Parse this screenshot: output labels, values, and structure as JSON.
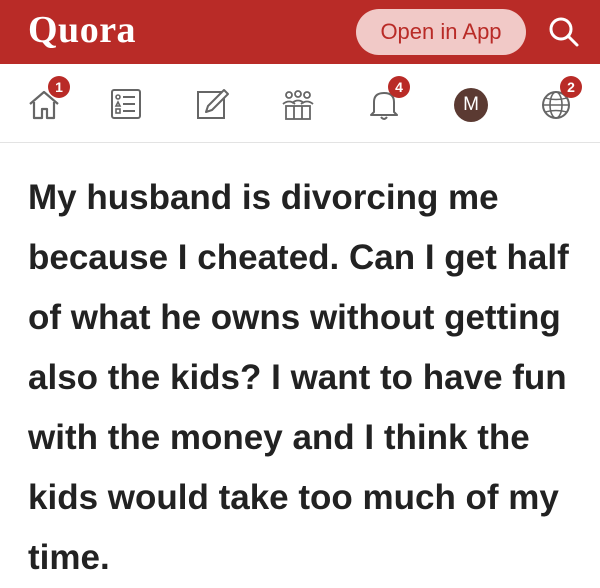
{
  "header": {
    "logo": "Quora",
    "open_in_app": "Open in App",
    "search_icon": "search-icon",
    "background_color": "#b92b27"
  },
  "nav": {
    "items": [
      {
        "icon": "home-icon",
        "badge": "1"
      },
      {
        "icon": "answer-list-icon",
        "badge": ""
      },
      {
        "icon": "write-icon",
        "badge": ""
      },
      {
        "icon": "spaces-icon",
        "badge": ""
      },
      {
        "icon": "notifications-bell-icon",
        "badge": "4"
      },
      {
        "icon": "profile-avatar",
        "badge": "",
        "avatar_letter": "M"
      },
      {
        "icon": "languages-globe-icon",
        "badge": "2"
      }
    ]
  },
  "question": {
    "text": "My husband is divorcing me because I cheated. Can I get half of what he owns without getting also the kids? I want to have fun with the money and I think the kids would take too much of my time."
  }
}
